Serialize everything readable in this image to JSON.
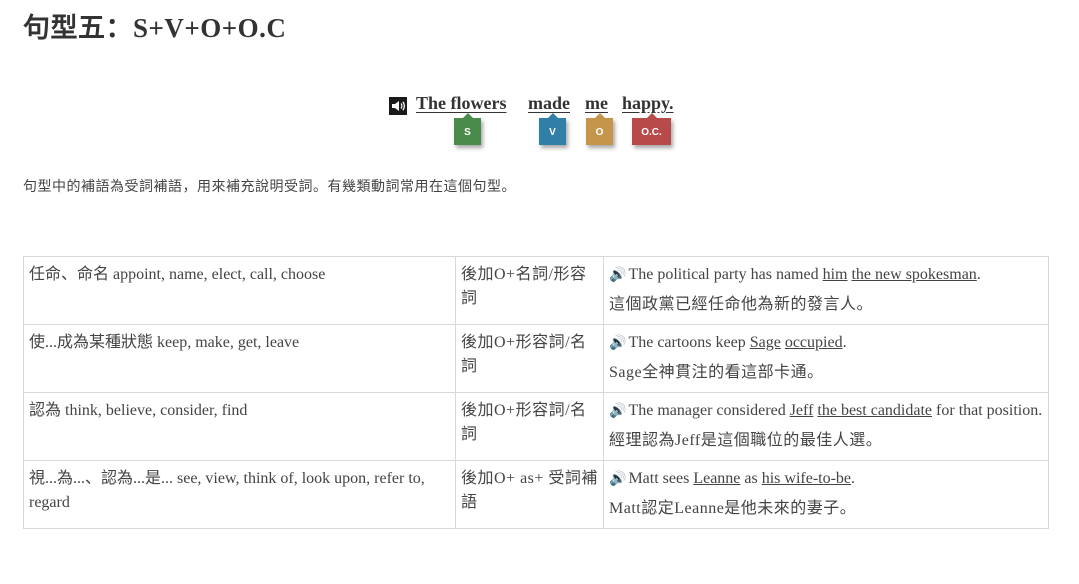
{
  "title": "句型五：S+V+O+O.C",
  "example": {
    "words": [
      "The flowers",
      "made",
      "me",
      "happy."
    ],
    "tags": [
      "S",
      "V",
      "O",
      "O.C."
    ],
    "tag_colors": [
      "#4a8a4a",
      "#2f7fa8",
      "#c4954a",
      "#b84a4a"
    ],
    "icon": "speaker-icon"
  },
  "description": "句型中的補語為受詞補語，用來補充說明受詞。有幾類動詞常用在這個句型。",
  "table": {
    "rows": [
      {
        "verbs": "任命、命名 appoint, name, elect, call, choose",
        "pattern": "後加O+名詞/形容詞",
        "example_parts": [
          "The political party has named ",
          "him",
          " ",
          "the new spokesman",
          "."
        ],
        "translation": "這個政黨已經任命他為新的發言人。"
      },
      {
        "verbs": "使...成為某種狀態 keep, make, get, leave",
        "pattern": "後加O+形容詞/名詞",
        "example_parts": [
          "The cartoons keep ",
          "Sage",
          " ",
          "occupied",
          "."
        ],
        "translation": "Sage全神貫注的看這部卡通。"
      },
      {
        "verbs": "認為 think, believe, consider, find",
        "pattern": "後加O+形容詞/名詞",
        "example_parts": [
          "The manager considered ",
          "Jeff",
          " ",
          "the best candidate",
          " for that position."
        ],
        "translation": "經理認為Jeff是這個職位的最佳人選。"
      },
      {
        "verbs": "視...為...、認為...是... see, view, think of, look upon, refer to, regard",
        "pattern": "後加O+ as+ 受詞補語",
        "example_parts": [
          "Matt sees ",
          "Leanne",
          " as ",
          "his wife-to-be",
          "."
        ],
        "translation": "Matt認定Leanne是他未來的妻子。"
      }
    ]
  }
}
